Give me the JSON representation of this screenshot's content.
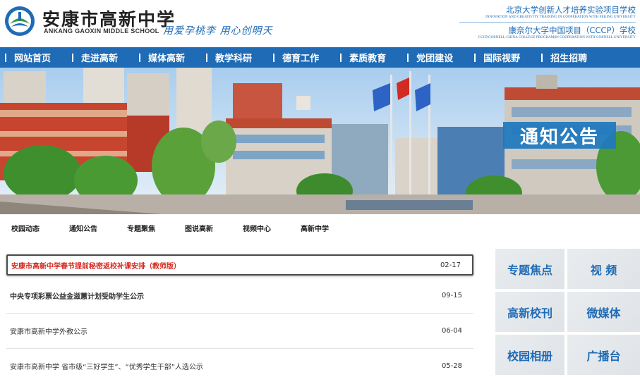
{
  "header": {
    "school_cn": "安康市高新中学",
    "school_en": "ANKANG  GAOXIN  MIDDLE  SCHOOL",
    "slogan": "用爱孕桃李 用心创明天",
    "partner1_cn": "北京大学创新人才培养实验项目学校",
    "partner1_en": "INNOVATION AND CREATIVITY TRAINING IN COOPERATION WITH PEKING UNIVERSITY",
    "partner2_cn": "康奈尔大学中国项目（CCCP）学校",
    "partner2_en": "CCCP|CORNELL-CHINA COLLEGE PROGRAM|IN COOPERATION WITH CORNELL UNIVERSITY"
  },
  "nav": {
    "items": [
      {
        "label": "网站首页"
      },
      {
        "label": "走进高新"
      },
      {
        "label": "媒体高新"
      },
      {
        "label": "教学科研"
      },
      {
        "label": "德育工作"
      },
      {
        "label": "素质教育"
      },
      {
        "label": "党团建设"
      },
      {
        "label": "国际视野"
      },
      {
        "label": "招生招聘"
      }
    ]
  },
  "banner": {
    "title": "通知公告"
  },
  "subnav": {
    "items": [
      {
        "label": "校园动态"
      },
      {
        "label": "通知公告"
      },
      {
        "label": "专题聚焦"
      },
      {
        "label": "图说高新"
      },
      {
        "label": "视频中心"
      },
      {
        "label": "高新中学"
      }
    ]
  },
  "news": {
    "items": [
      {
        "title": "安康市高新中学春节提前秘密返校补课安排（教师版）",
        "date": "02-17"
      },
      {
        "title": "中央专项彩票公益金滋蕙计划受助学生公示",
        "date": "09-15"
      },
      {
        "title": "安康市高新中学外教公示",
        "date": "06-04"
      },
      {
        "title": "安康市高新中学 省市级“三好学生”、“优秀学生干部”人选公示",
        "date": "05-28"
      }
    ]
  },
  "tiles": {
    "items": [
      {
        "label": "专题焦点"
      },
      {
        "label": "视 频"
      },
      {
        "label": "高新校刊"
      },
      {
        "label": "微媒体"
      },
      {
        "label": "校园相册"
      },
      {
        "label": "广播台"
      }
    ]
  },
  "colors": {
    "brand_blue": "#1f6bb5",
    "highlight_red": "#d62a20"
  }
}
